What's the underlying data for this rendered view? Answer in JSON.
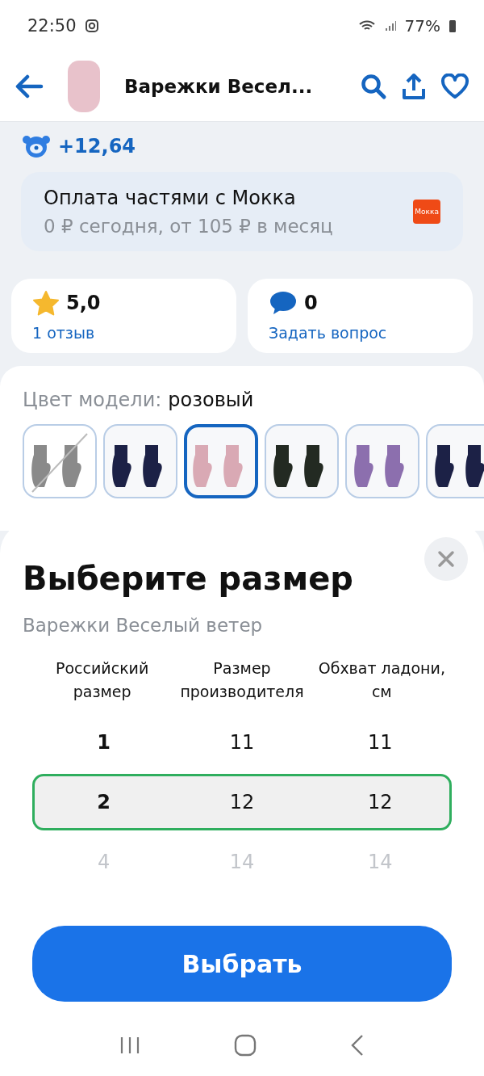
{
  "status_bar": {
    "time": "22:50",
    "battery": "77%"
  },
  "header": {
    "title": "Варежки Весел..."
  },
  "bonus": {
    "amount": "+12,64"
  },
  "installments": {
    "title": "Оплата частями с Мокка",
    "subtitle": "0 ₽ сегодня, от 105 ₽ в месяц",
    "logo": "Мокка"
  },
  "rating": {
    "value": "5,0",
    "link": "1 отзыв"
  },
  "questions": {
    "value": "0",
    "link": "Задать вопрос"
  },
  "color_picker": {
    "label": "Цвет модели:",
    "value": "розовый",
    "swatches": [
      {
        "color": "#8a8a8a",
        "available": false,
        "selected": false
      },
      {
        "color": "#1c2146",
        "available": true,
        "selected": false
      },
      {
        "color": "#d9a9b4",
        "available": true,
        "selected": true
      },
      {
        "color": "#232a22",
        "available": true,
        "selected": false
      },
      {
        "color": "#8c6fae",
        "available": true,
        "selected": false
      },
      {
        "color": "#1c2146",
        "available": true,
        "selected": false
      }
    ]
  },
  "size_sheet": {
    "title": "Выберите размер",
    "subtitle": "Варежки Веселый ветер",
    "columns": [
      "Российский размер",
      "Размер производителя",
      "Обхват ладони, см"
    ],
    "rows": [
      {
        "cells": [
          "1",
          "11",
          "11"
        ],
        "selected": false,
        "disabled": false
      },
      {
        "cells": [
          "2",
          "12",
          "12"
        ],
        "selected": true,
        "disabled": false
      },
      {
        "cells": [
          "4",
          "14",
          "14"
        ],
        "selected": false,
        "disabled": true
      }
    ],
    "button": "Выбрать"
  }
}
